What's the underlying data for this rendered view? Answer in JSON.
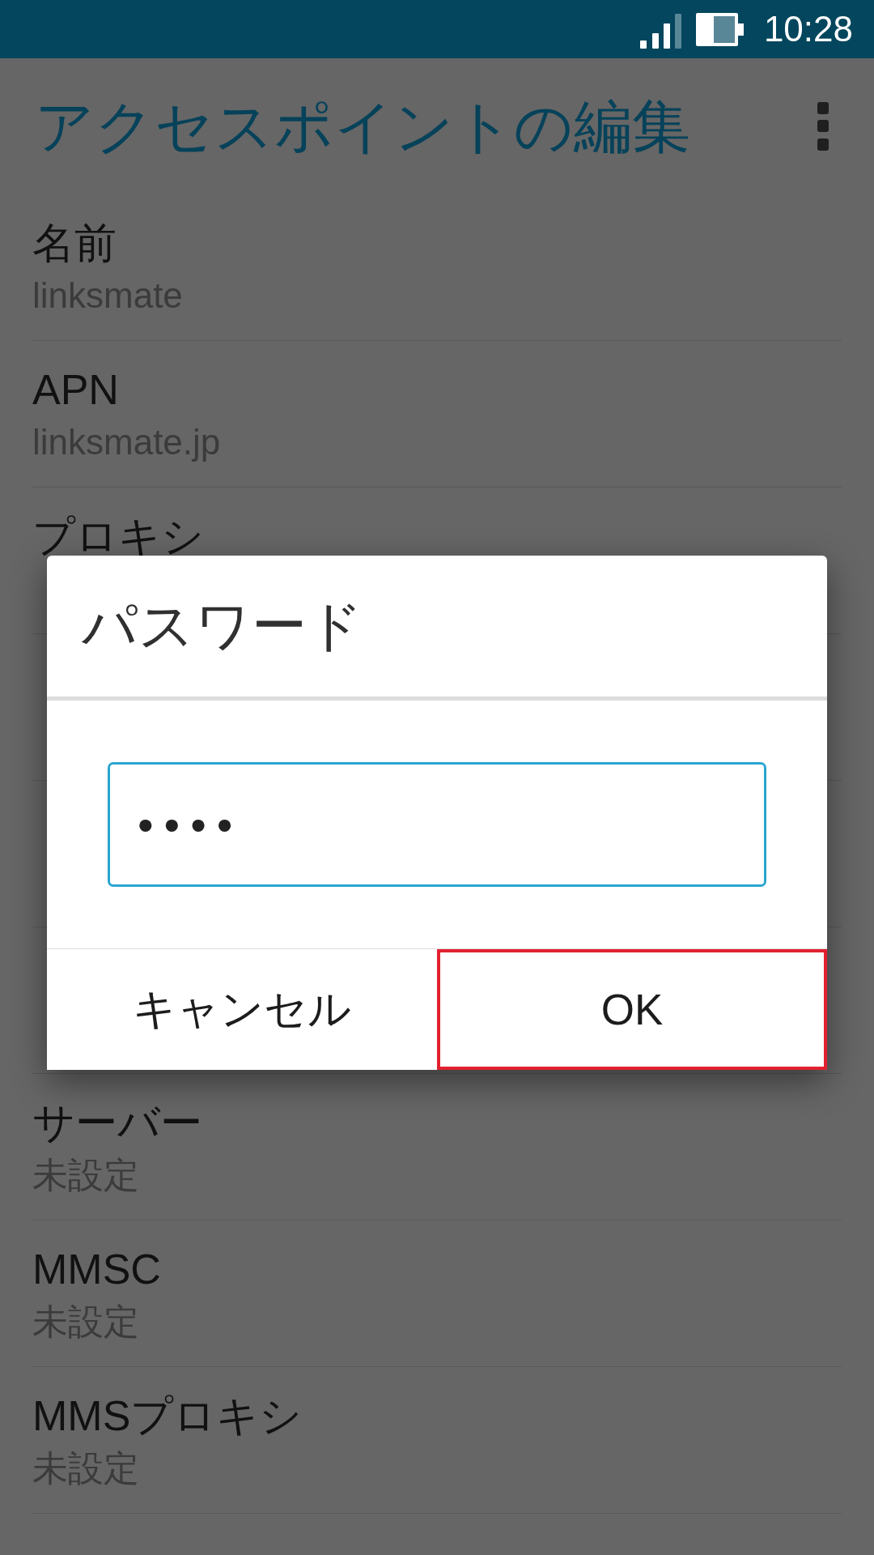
{
  "status_bar": {
    "time": "10:28"
  },
  "app_bar": {
    "title": "アクセスポイントの編集"
  },
  "settings": [
    {
      "kind": "setting",
      "title": "名前",
      "value": "linksmate"
    },
    {
      "kind": "setting",
      "title": "APN",
      "value": "linksmate.jp"
    },
    {
      "kind": "setting",
      "title": "プロキシ"
    },
    {
      "kind": "covered"
    },
    {
      "kind": "covered"
    },
    {
      "kind": "covered"
    },
    {
      "kind": "setting",
      "title": "サーバー",
      "value": "未設定"
    },
    {
      "kind": "setting",
      "title": "MMSC",
      "value": "未設定"
    },
    {
      "kind": "setting",
      "title": "MMSプロキシ",
      "value": "未設定"
    }
  ],
  "dialog": {
    "title": "パスワード",
    "field": {
      "value": "••••",
      "focused": true
    },
    "buttons": [
      {
        "label": "キャンセル",
        "highlighted": false
      },
      {
        "label": "OK",
        "highlighted": true
      }
    ]
  }
}
